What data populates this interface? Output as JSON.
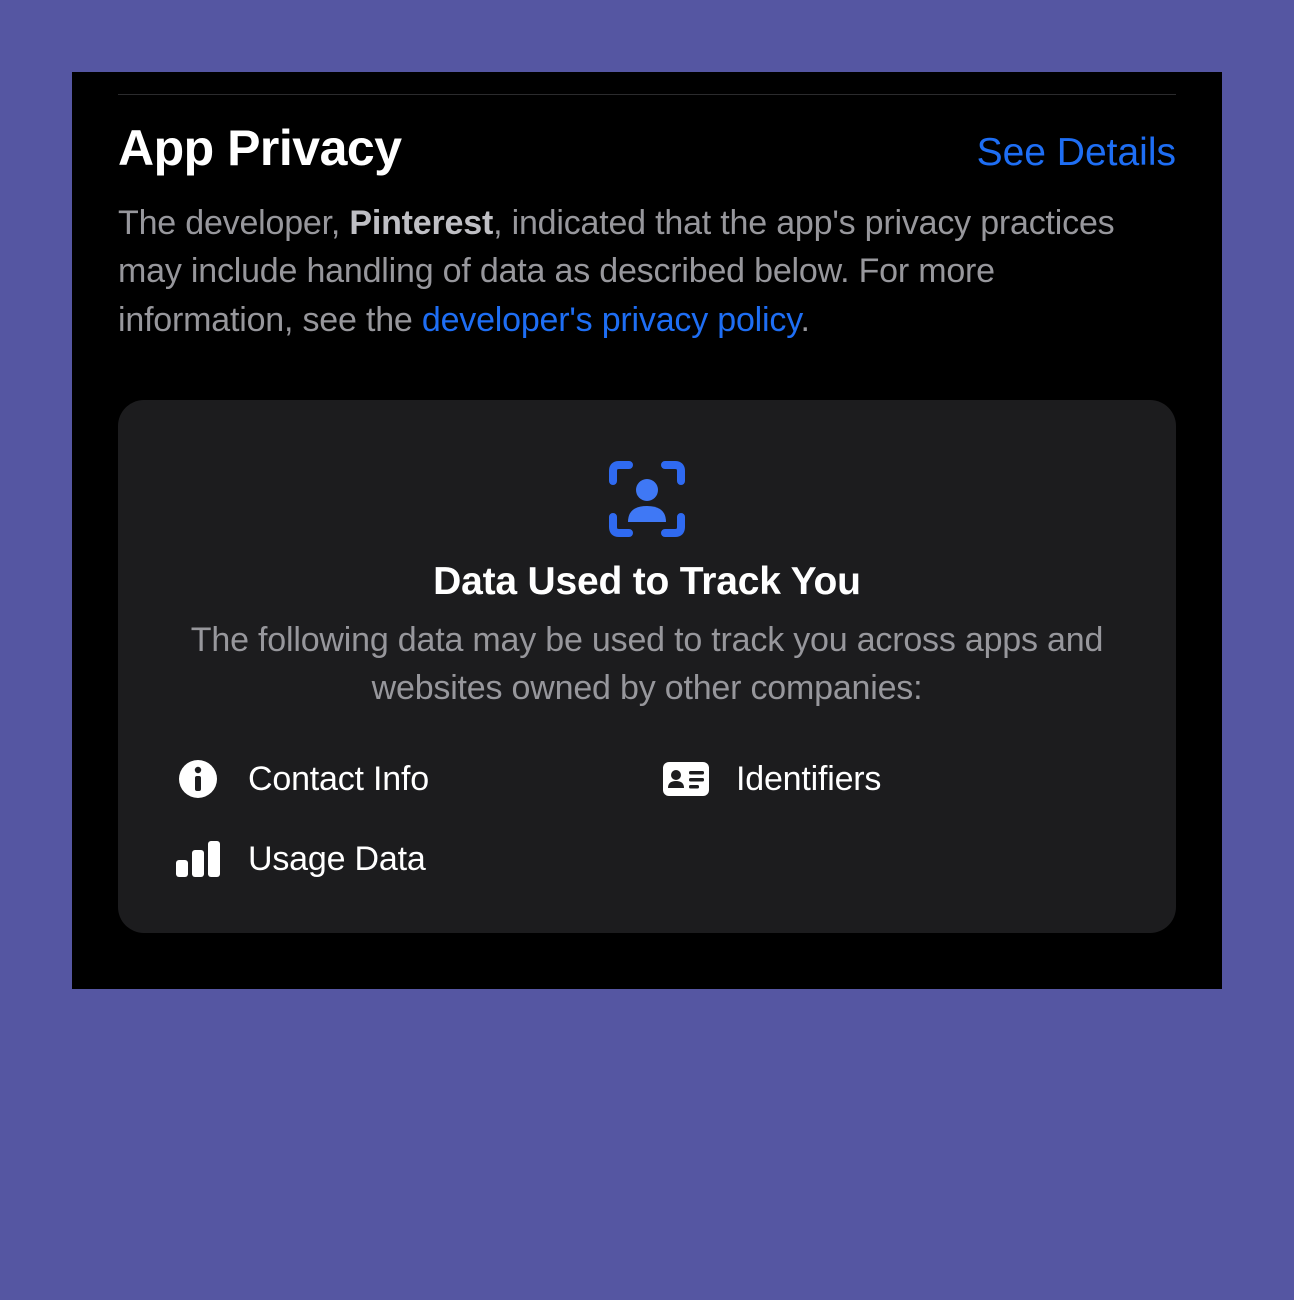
{
  "header": {
    "title": "App Privacy",
    "see_details": "See Details"
  },
  "description": {
    "prefix": "The developer, ",
    "developer_name": "Pinterest",
    "middle": ", indicated that the app's privacy practices may include handling of data as described below. For more information, see the ",
    "policy_link": "developer's privacy policy",
    "suffix": "."
  },
  "card": {
    "title": "Data Used to Track You",
    "description": "The following data may be used to track you across apps and websites owned by other companies:",
    "items": [
      {
        "label": "Contact Info"
      },
      {
        "label": "Identifiers"
      },
      {
        "label": "Usage Data"
      }
    ]
  }
}
